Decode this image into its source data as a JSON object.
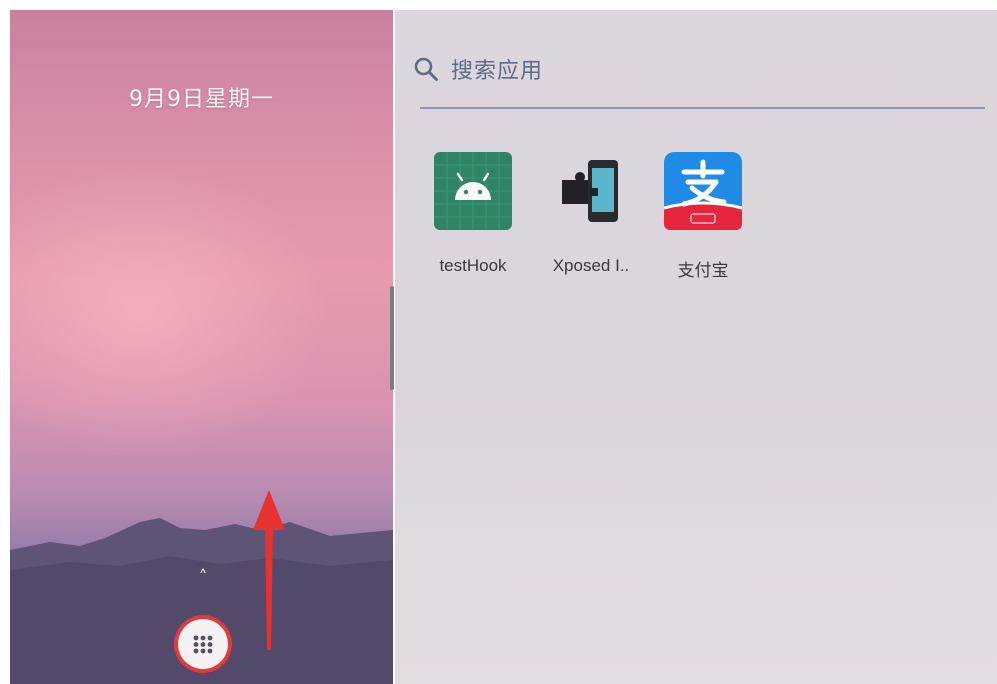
{
  "home_screen": {
    "date": "9月9日星期一",
    "up_chevron": "˄"
  },
  "app_drawer": {
    "search": {
      "placeholder": "搜索应用"
    },
    "apps": [
      {
        "name": "testHook",
        "icon": "android-robot-icon"
      },
      {
        "name": "Xposed I..",
        "icon": "xposed-puzzle-phone-icon"
      },
      {
        "name": "支付宝",
        "icon": "alipay-icon"
      }
    ]
  },
  "colors": {
    "annotation_red": "#e23b3b",
    "testhook_green": "#2f8466",
    "alipay_blue": "#1f8be6",
    "xposed_teal": "#5ab6c8"
  }
}
